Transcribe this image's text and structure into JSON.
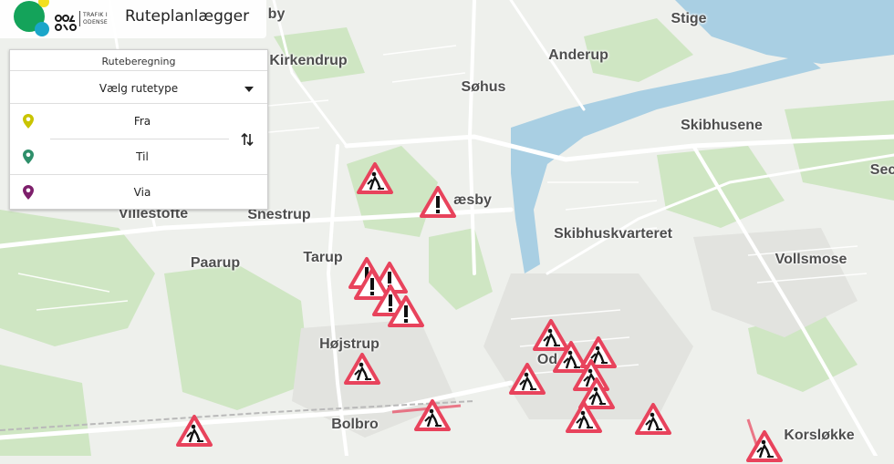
{
  "header": {
    "logo_text": "ode\nose",
    "org_line1": "TRAFIK I",
    "org_line2": "ODENSE",
    "title": "Ruteplanlægger"
  },
  "panel": {
    "title": "Ruteberegning",
    "route_type_label": "Vælg rutetype",
    "stops": [
      {
        "label": "Fra",
        "pin_color": "#c9c400"
      },
      {
        "label": "Til",
        "pin_color": "#2e8f6a"
      },
      {
        "label": "Via",
        "pin_color": "#7d1f6b"
      }
    ],
    "swap_icon": "swap-vertical-icon"
  },
  "map": {
    "places": [
      "Stige",
      "Kirkendrup",
      "Anderup",
      "Søhus",
      "Skibhusene",
      "Villestofte",
      "Villestofte",
      "Snestrup",
      "æsby",
      "Skibhuskvarteret",
      "Vollsmose",
      "Paarup",
      "Tarup",
      "Højstrup",
      "Od",
      "Bolbro",
      "Korsløkke",
      "Sec",
      "by"
    ],
    "marker_colors": {
      "border": "#e8435c",
      "fill": "#ffffff",
      "glyph": "#111111"
    }
  }
}
